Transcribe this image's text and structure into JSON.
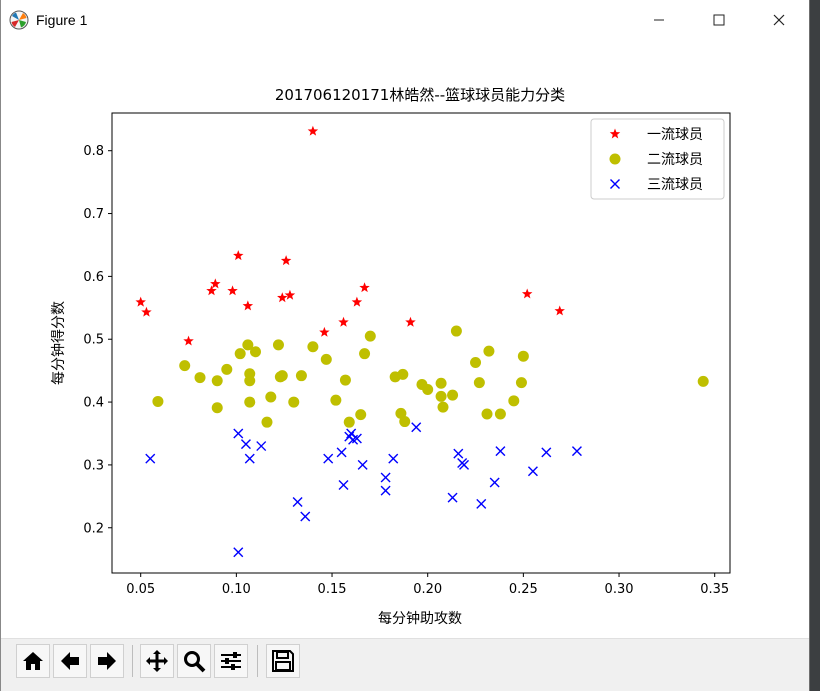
{
  "window": {
    "title": "Figure 1"
  },
  "colors": {
    "first_class": "#ff0000",
    "second_class": "#bfbf00",
    "third_class": "#0000ff",
    "axes": "#000000"
  },
  "toolbar": {
    "buttons": [
      "home-icon",
      "back-icon",
      "forward-icon",
      "pan-icon",
      "zoom-icon",
      "configure-subplots-icon",
      "save-icon"
    ]
  },
  "chart_data": {
    "type": "scatter",
    "title": "201706120171林皓然--篮球球员能力分类",
    "xlabel": "每分钟助攻数",
    "ylabel": "每分钟得分数",
    "xlim": [
      0.035,
      0.358
    ],
    "ylim": [
      0.128,
      0.86
    ],
    "xticks": [
      "0.05",
      "0.10",
      "0.15",
      "0.20",
      "0.25",
      "0.30",
      "0.35"
    ],
    "xtick_values": [
      0.05,
      0.1,
      0.15,
      0.2,
      0.25,
      0.3,
      0.35
    ],
    "yticks": [
      "0.2",
      "0.3",
      "0.4",
      "0.5",
      "0.6",
      "0.7",
      "0.8"
    ],
    "ytick_values": [
      0.2,
      0.3,
      0.4,
      0.5,
      0.6,
      0.7,
      0.8
    ],
    "grid": false,
    "legend_position": "top-right",
    "series": [
      {
        "name": "一流球员",
        "marker": "star",
        "color": "#ff0000",
        "points": [
          [
            0.05,
            0.559
          ],
          [
            0.053,
            0.543
          ],
          [
            0.075,
            0.497
          ],
          [
            0.087,
            0.577
          ],
          [
            0.089,
            0.588
          ],
          [
            0.098,
            0.577
          ],
          [
            0.101,
            0.633
          ],
          [
            0.106,
            0.553
          ],
          [
            0.124,
            0.566
          ],
          [
            0.126,
            0.625
          ],
          [
            0.128,
            0.57
          ],
          [
            0.14,
            0.831
          ],
          [
            0.146,
            0.511
          ],
          [
            0.156,
            0.527
          ],
          [
            0.163,
            0.559
          ],
          [
            0.167,
            0.582
          ],
          [
            0.191,
            0.527
          ],
          [
            0.252,
            0.572
          ],
          [
            0.269,
            0.545
          ]
        ]
      },
      {
        "name": "二流球员",
        "marker": "circle",
        "color": "#bfbf00",
        "points": [
          [
            0.059,
            0.401
          ],
          [
            0.073,
            0.458
          ],
          [
            0.081,
            0.439
          ],
          [
            0.09,
            0.391
          ],
          [
            0.09,
            0.434
          ],
          [
            0.095,
            0.452
          ],
          [
            0.102,
            0.477
          ],
          [
            0.106,
            0.491
          ],
          [
            0.107,
            0.434
          ],
          [
            0.107,
            0.445
          ],
          [
            0.107,
            0.4
          ],
          [
            0.11,
            0.48
          ],
          [
            0.116,
            0.368
          ],
          [
            0.118,
            0.408
          ],
          [
            0.122,
            0.491
          ],
          [
            0.123,
            0.44
          ],
          [
            0.124,
            0.442
          ],
          [
            0.13,
            0.4
          ],
          [
            0.134,
            0.442
          ],
          [
            0.14,
            0.488
          ],
          [
            0.147,
            0.468
          ],
          [
            0.152,
            0.403
          ],
          [
            0.157,
            0.435
          ],
          [
            0.159,
            0.368
          ],
          [
            0.165,
            0.38
          ],
          [
            0.167,
            0.477
          ],
          [
            0.17,
            0.505
          ],
          [
            0.183,
            0.44
          ],
          [
            0.186,
            0.382
          ],
          [
            0.187,
            0.444
          ],
          [
            0.188,
            0.369
          ],
          [
            0.197,
            0.428
          ],
          [
            0.2,
            0.42
          ],
          [
            0.207,
            0.43
          ],
          [
            0.207,
            0.409
          ],
          [
            0.208,
            0.392
          ],
          [
            0.213,
            0.411
          ],
          [
            0.215,
            0.513
          ],
          [
            0.225,
            0.463
          ],
          [
            0.227,
            0.431
          ],
          [
            0.231,
            0.381
          ],
          [
            0.232,
            0.481
          ],
          [
            0.238,
            0.381
          ],
          [
            0.245,
            0.402
          ],
          [
            0.249,
            0.431
          ],
          [
            0.25,
            0.473
          ],
          [
            0.344,
            0.433
          ]
        ]
      },
      {
        "name": "三流球员",
        "marker": "x",
        "color": "#0000ff",
        "points": [
          [
            0.055,
            0.31
          ],
          [
            0.101,
            0.35
          ],
          [
            0.101,
            0.161
          ],
          [
            0.105,
            0.333
          ],
          [
            0.107,
            0.31
          ],
          [
            0.113,
            0.33
          ],
          [
            0.132,
            0.241
          ],
          [
            0.136,
            0.218
          ],
          [
            0.148,
            0.31
          ],
          [
            0.155,
            0.32
          ],
          [
            0.156,
            0.268
          ],
          [
            0.159,
            0.345
          ],
          [
            0.16,
            0.35
          ],
          [
            0.161,
            0.34
          ],
          [
            0.163,
            0.342
          ],
          [
            0.166,
            0.3
          ],
          [
            0.178,
            0.28
          ],
          [
            0.178,
            0.259
          ],
          [
            0.182,
            0.31
          ],
          [
            0.194,
            0.36
          ],
          [
            0.213,
            0.248
          ],
          [
            0.216,
            0.318
          ],
          [
            0.218,
            0.303
          ],
          [
            0.219,
            0.3
          ],
          [
            0.228,
            0.238
          ],
          [
            0.235,
            0.272
          ],
          [
            0.238,
            0.322
          ],
          [
            0.255,
            0.29
          ],
          [
            0.262,
            0.32
          ],
          [
            0.278,
            0.322
          ]
        ]
      }
    ]
  }
}
